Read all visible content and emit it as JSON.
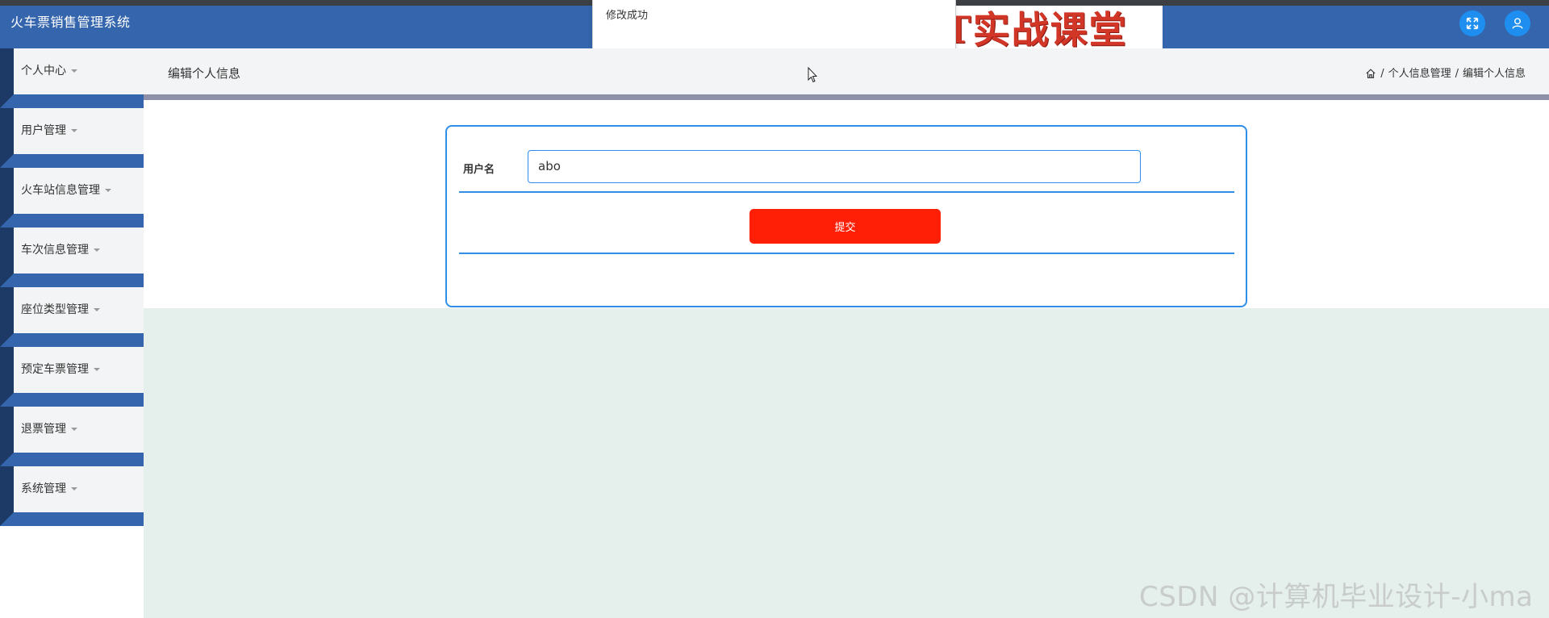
{
  "header": {
    "app_title": "火车票销售管理系统",
    "fullscreen_icon": "fullscreen-icon",
    "user_icon": "user-icon",
    "accent_color": "#3566ad",
    "button_color": "#1e8ff1"
  },
  "dialog": {
    "message": "修改成功"
  },
  "logo": {
    "text": "IT实战课堂"
  },
  "sidebar": {
    "items": [
      {
        "label": "个人中心"
      },
      {
        "label": "用户管理"
      },
      {
        "label": "火车站信息管理"
      },
      {
        "label": "车次信息管理"
      },
      {
        "label": "座位类型管理"
      },
      {
        "label": "预定车票管理"
      },
      {
        "label": "退票管理"
      },
      {
        "label": "系统管理"
      }
    ]
  },
  "subheader": {
    "page_title": "编辑个人信息",
    "breadcrumb": [
      "个人信息管理",
      "编辑个人信息"
    ],
    "breadcrumb_sep": "/",
    "home_icon": "home-icon"
  },
  "form": {
    "username_label": "用户名",
    "username_value": "abo",
    "submit_label": "提交",
    "submit_color": "#ff1e06"
  },
  "watermark": {
    "text": "CSDN @计算机毕业设计-小ma"
  }
}
